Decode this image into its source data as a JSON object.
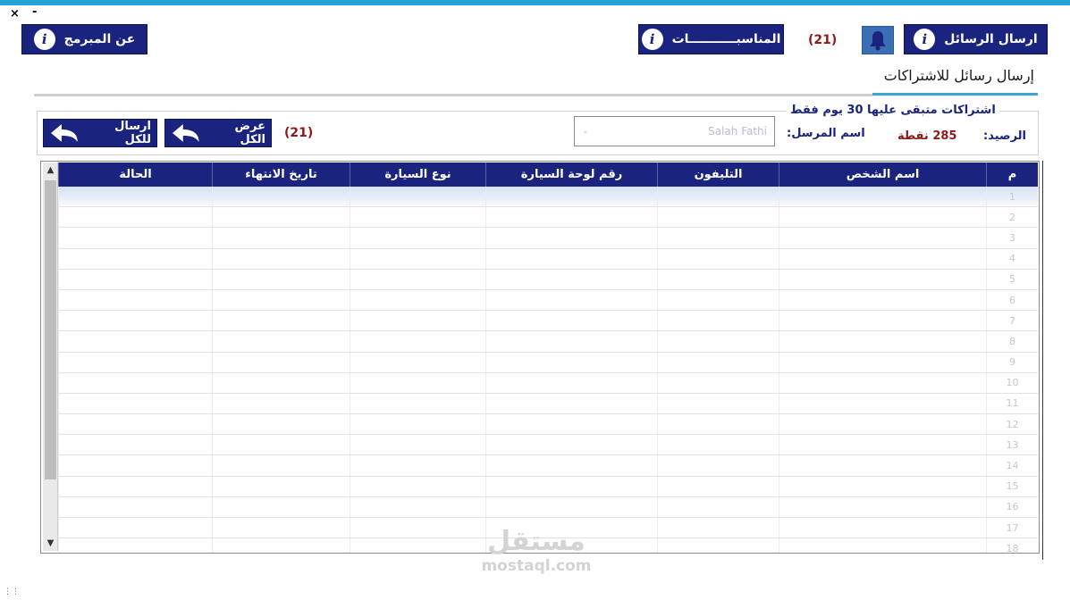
{
  "window": {
    "minimize_glyph": "-",
    "close_glyph": "×"
  },
  "header": {
    "send_messages_label": "ارسال الرسائل",
    "notifications_count": "(21)",
    "occasions_label": "المناسبـــــــــــات",
    "about_label": "عن المبرمج"
  },
  "section": {
    "title": "إرسال رسائل للاشتراكات"
  },
  "filter": {
    "legend": "اشتراكات متبقى عليها 30 يوم فقط",
    "balance_label": "الرصيد:",
    "balance_value": "285 نقطة",
    "sender_label": "اسم المرسل:",
    "sender_value": "Salah Fathi",
    "count": "(21)",
    "show_all_label": "عرض الكل",
    "send_all_label": "ارسال للكل"
  },
  "table": {
    "columns": [
      "م",
      "اسم الشخص",
      "التليفون",
      "رقم لوحة السيارة",
      "نوع السيارة",
      "تاريخ الانتهاء",
      "الحالة"
    ],
    "rows": [
      [
        "1",
        "",
        "",
        "",
        "",
        "",
        ""
      ],
      [
        "2",
        "",
        "",
        "",
        "",
        "",
        ""
      ],
      [
        "3",
        "",
        "",
        "",
        "",
        "",
        ""
      ],
      [
        "4",
        "",
        "",
        "",
        "",
        "",
        ""
      ],
      [
        "5",
        "",
        "",
        "",
        "",
        "",
        ""
      ],
      [
        "6",
        "",
        "",
        "",
        "",
        "",
        ""
      ],
      [
        "7",
        "",
        "",
        "",
        "",
        "",
        ""
      ],
      [
        "8",
        "",
        "",
        "",
        "",
        "",
        ""
      ],
      [
        "9",
        "",
        "",
        "",
        "",
        "",
        ""
      ],
      [
        "10",
        "",
        "",
        "",
        "",
        "",
        ""
      ],
      [
        "11",
        "",
        "",
        "",
        "",
        "",
        ""
      ],
      [
        "12",
        "",
        "",
        "",
        "",
        "",
        ""
      ],
      [
        "13",
        "",
        "",
        "",
        "",
        "",
        ""
      ],
      [
        "14",
        "",
        "",
        "",
        "",
        "",
        ""
      ],
      [
        "15",
        "",
        "",
        "",
        "",
        "",
        ""
      ],
      [
        "16",
        "",
        "",
        "",
        "",
        "",
        ""
      ],
      [
        "17",
        "",
        "",
        "",
        "",
        "",
        ""
      ],
      [
        "18",
        "",
        "",
        "",
        "",
        "",
        ""
      ]
    ]
  },
  "watermark": {
    "arabic": "مستقل",
    "latin": "mostaql.com"
  },
  "colors": {
    "accent": "#1a237e",
    "topbar": "#22a3d8",
    "count": "#8b1a1a",
    "bell": "#3b6fb5"
  },
  "icons": [
    "info-icon",
    "bell-icon",
    "back-arrow-icon",
    "scroll-up-icon",
    "scroll-down-icon",
    "dropdown-chevron-icon"
  ]
}
